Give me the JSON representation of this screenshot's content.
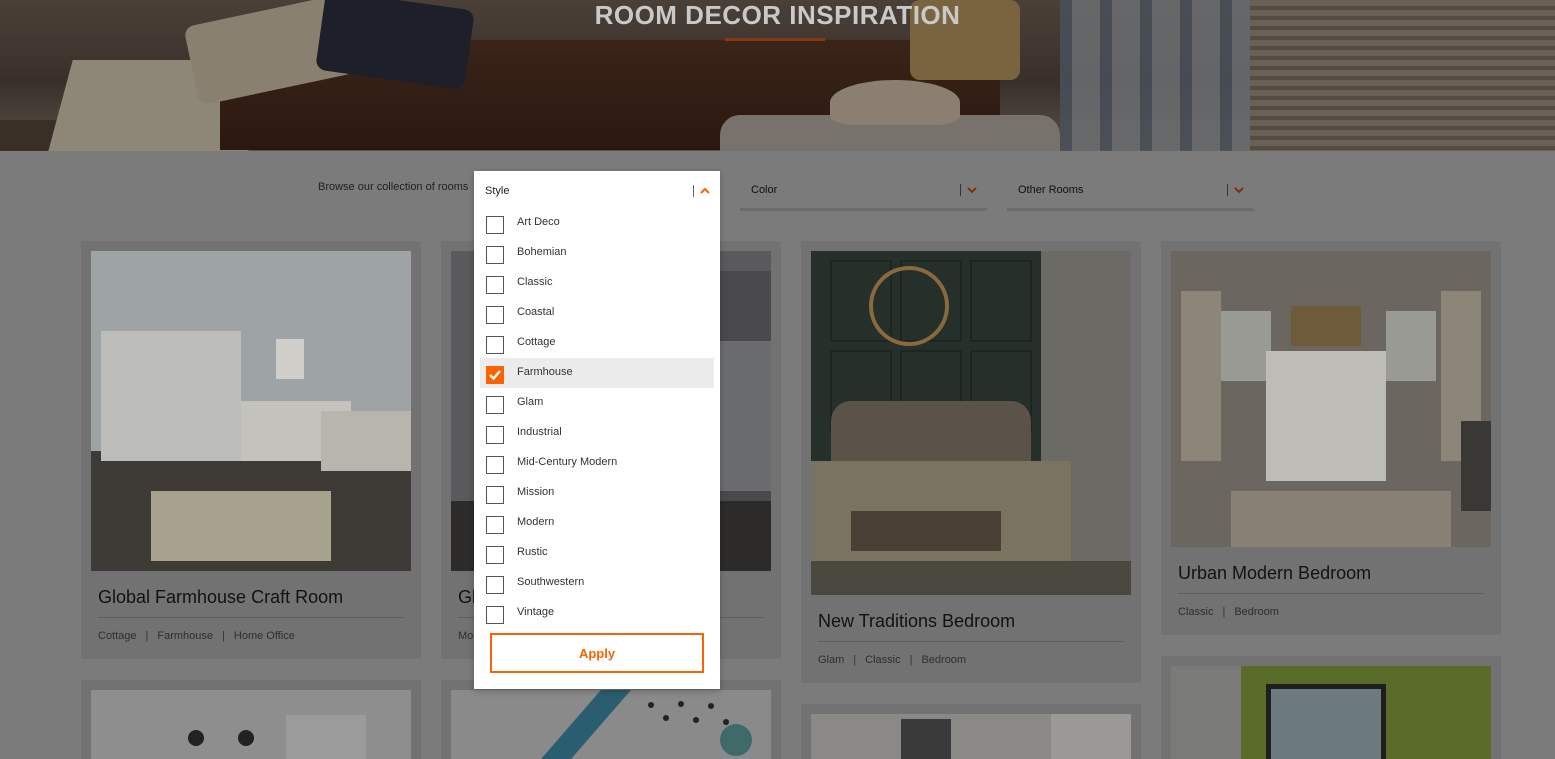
{
  "hero": {
    "title": "ROOM DECOR INSPIRATION"
  },
  "filters": {
    "browse_label": "Browse our collection of rooms",
    "style": {
      "label": "Style",
      "options": [
        {
          "label": "Art Deco",
          "checked": false
        },
        {
          "label": "Bohemian",
          "checked": false
        },
        {
          "label": "Classic",
          "checked": false
        },
        {
          "label": "Coastal",
          "checked": false
        },
        {
          "label": "Cottage",
          "checked": false
        },
        {
          "label": "Farmhouse",
          "checked": true
        },
        {
          "label": "Glam",
          "checked": false
        },
        {
          "label": "Industrial",
          "checked": false
        },
        {
          "label": "Mid-Century Modern",
          "checked": false
        },
        {
          "label": "Mission",
          "checked": false
        },
        {
          "label": "Modern",
          "checked": false
        },
        {
          "label": "Rustic",
          "checked": false
        },
        {
          "label": "Southwestern",
          "checked": false
        },
        {
          "label": "Vintage",
          "checked": false
        }
      ],
      "apply_label": "Apply"
    },
    "color": {
      "label": "Color"
    },
    "other_rooms": {
      "label": "Other Rooms"
    }
  },
  "cards": [
    {
      "title": "Global Farmhouse Craft Room",
      "tags": [
        "Cottage",
        "Farmhouse",
        "Home Office"
      ]
    },
    {
      "title": "Gl",
      "tags": [
        "Mo"
      ]
    },
    {
      "title": "New Traditions Bedroom",
      "tags": [
        "Glam",
        "Classic",
        "Bedroom"
      ]
    },
    {
      "title": "Urban Modern Bedroom",
      "tags": [
        "Classic",
        "Bedroom"
      ]
    }
  ],
  "colors": {
    "accent": "#f96302"
  }
}
